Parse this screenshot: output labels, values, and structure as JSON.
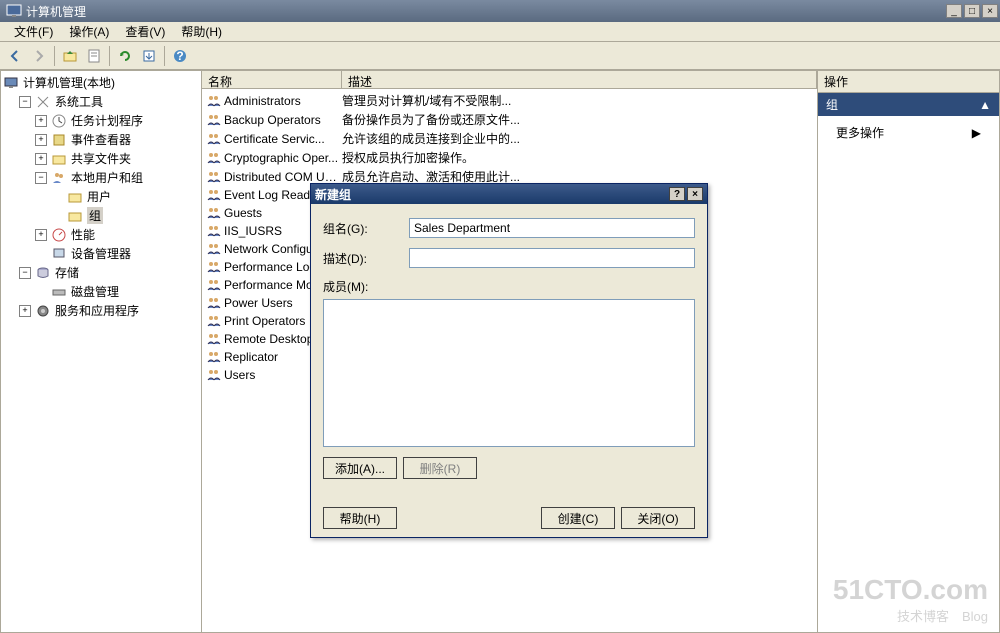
{
  "window": {
    "title": "计算机管理",
    "min": "_",
    "max": "□",
    "close": "×"
  },
  "menu": {
    "file": "文件(F)",
    "action": "操作(A)",
    "view": "查看(V)",
    "help": "帮助(H)"
  },
  "tree": {
    "root": "计算机管理(本地)",
    "system_tools": "系统工具",
    "task_scheduler": "任务计划程序",
    "event_viewer": "事件查看器",
    "shared_folders": "共享文件夹",
    "local_users_groups": "本地用户和组",
    "users": "用户",
    "groups": "组",
    "performance": "性能",
    "device_manager": "设备管理器",
    "storage": "存储",
    "disk_management": "磁盘管理",
    "services_apps": "服务和应用程序"
  },
  "list": {
    "header_name": "名称",
    "header_desc": "描述",
    "rows": [
      {
        "name": "Administrators",
        "desc": "管理员对计算机/域有不受限制..."
      },
      {
        "name": "Backup Operators",
        "desc": "备份操作员为了备份或还原文件..."
      },
      {
        "name": "Certificate Servic...",
        "desc": "允许该组的成员连接到企业中的..."
      },
      {
        "name": "Cryptographic Oper...",
        "desc": "授权成员执行加密操作。"
      },
      {
        "name": "Distributed COM Users",
        "desc": "成员允许启动、激活和使用此计..."
      },
      {
        "name": "Event Log Reade",
        "desc": ""
      },
      {
        "name": "Guests",
        "desc": ""
      },
      {
        "name": "IIS_IUSRS",
        "desc": ""
      },
      {
        "name": "Network Configu",
        "desc": ""
      },
      {
        "name": "Performance Log",
        "desc": ""
      },
      {
        "name": "Performance Mon",
        "desc": ""
      },
      {
        "name": "Power Users",
        "desc": ""
      },
      {
        "name": "Print Operators",
        "desc": ""
      },
      {
        "name": "Remote Desktop",
        "desc": ""
      },
      {
        "name": "Replicator",
        "desc": ""
      },
      {
        "name": "Users",
        "desc": ""
      }
    ]
  },
  "actions": {
    "header": "操作",
    "group_title": "组",
    "more_actions": "更多操作"
  },
  "dialog": {
    "title": "新建组",
    "help_q": "?",
    "close_x": "×",
    "name_label": "组名(G):",
    "name_value": "Sales Department",
    "desc_label": "描述(D):",
    "desc_value": "",
    "members_label": "成员(M):",
    "add_btn": "添加(A)...",
    "remove_btn": "删除(R)",
    "help_btn": "帮助(H)",
    "create_btn": "创建(C)",
    "close_btn": "关闭(O)"
  },
  "watermark": {
    "big": "51CTO.com",
    "small": "技术博客　Blog"
  }
}
